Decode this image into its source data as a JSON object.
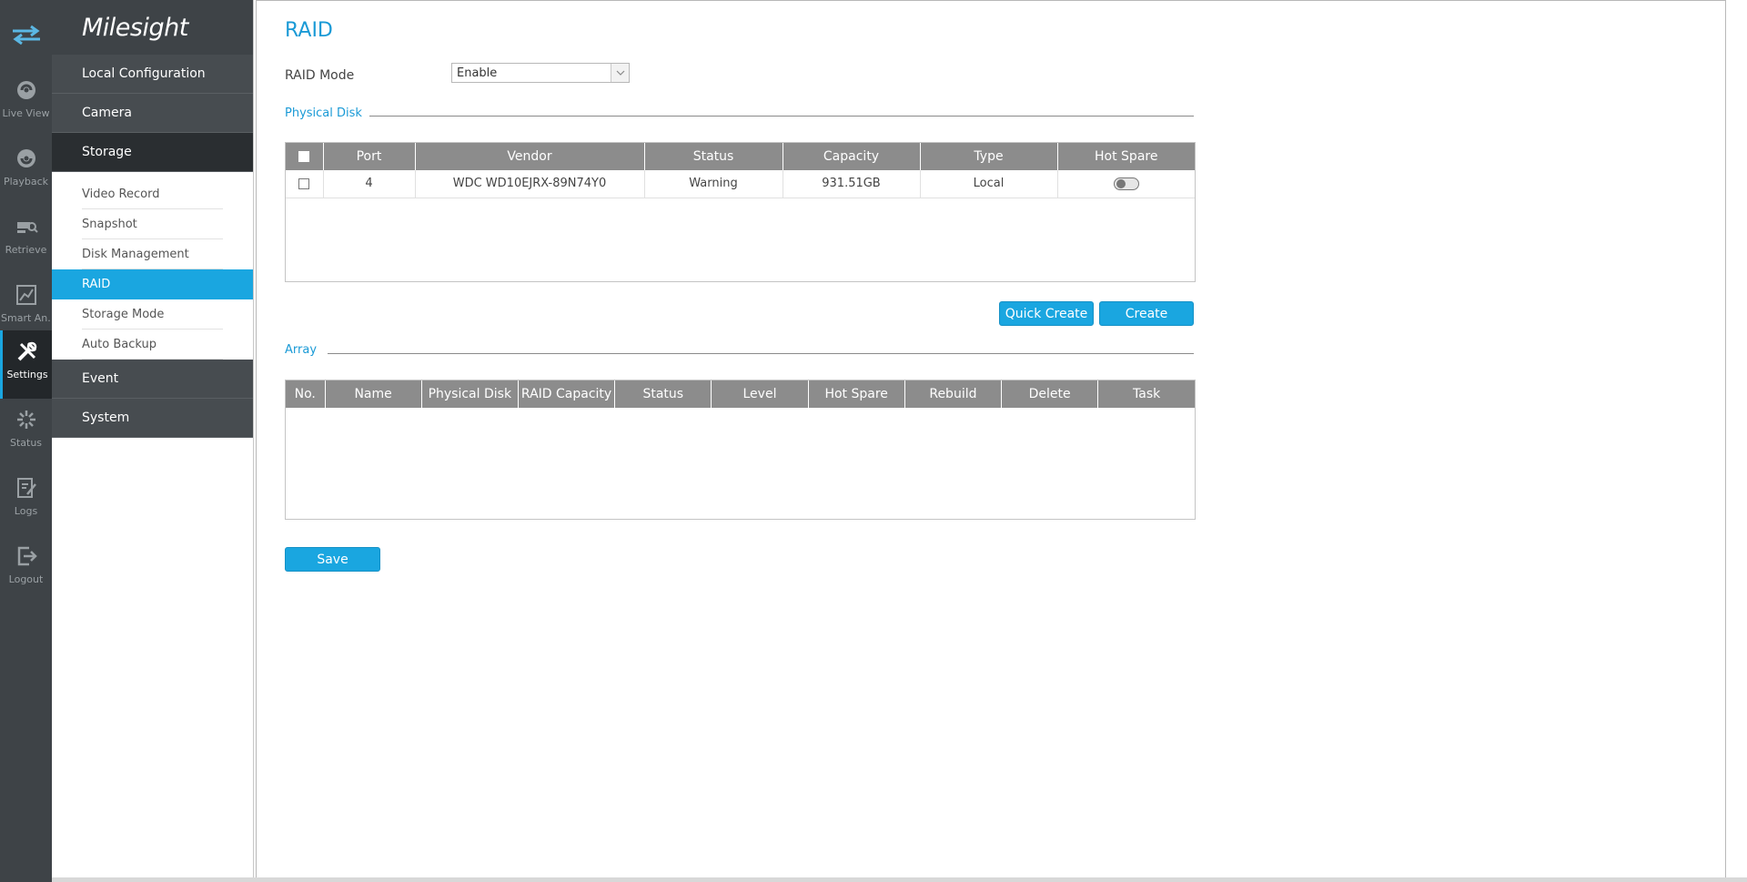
{
  "rail": {
    "items": [
      {
        "label": "Live View",
        "icon": "live-view-icon"
      },
      {
        "label": "Playback",
        "icon": "playback-icon"
      },
      {
        "label": "Retrieve",
        "icon": "retrieve-icon"
      },
      {
        "label": "Smart An...",
        "icon": "smart-analysis-icon"
      },
      {
        "label": "Settings",
        "icon": "settings-icon"
      },
      {
        "label": "Status",
        "icon": "status-icon"
      },
      {
        "label": "Logs",
        "icon": "logs-icon"
      },
      {
        "label": "Logout",
        "icon": "logout-icon"
      }
    ],
    "active": "Settings"
  },
  "brand": {
    "logo_text": "Milesight"
  },
  "menu": {
    "local_configuration": "Local Configuration",
    "camera": "Camera",
    "storage": "Storage",
    "storage_sub": [
      {
        "label": "Video Record"
      },
      {
        "label": "Snapshot"
      },
      {
        "label": "Disk Management"
      },
      {
        "label": "RAID"
      },
      {
        "label": "Storage Mode"
      },
      {
        "label": "Auto Backup"
      }
    ],
    "event": "Event",
    "system": "System"
  },
  "page": {
    "title": "RAID",
    "raid_mode_label": "RAID Mode",
    "raid_mode_value": "Enable",
    "physical_disk_title": "Physical Disk",
    "array_title": "Array",
    "quick_create_label": "Quick Create",
    "create_label": "Create",
    "save_label": "Save"
  },
  "physical_disk_table": {
    "headers": [
      "Port",
      "Vendor",
      "Status",
      "Capacity",
      "Type",
      "Hot Spare"
    ],
    "rows": [
      {
        "port": "4",
        "vendor": "WDC WD10EJRX-89N74Y0",
        "status": "Warning",
        "capacity": "931.51GB",
        "type": "Local",
        "hot_spare": "off"
      }
    ]
  },
  "array_table": {
    "headers": [
      "No.",
      "Name",
      "Physical Disk",
      "RAID Capacity",
      "Status",
      "Level",
      "Hot Spare",
      "Rebuild",
      "Delete",
      "Task"
    ],
    "rows": []
  },
  "colors": {
    "accent": "#1aa6e0",
    "sidebar": "#3e4347",
    "header_gray": "#8c8c8c"
  }
}
